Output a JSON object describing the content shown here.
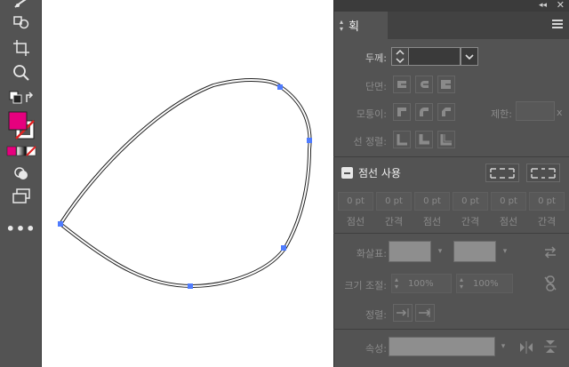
{
  "panel": {
    "tab_label": "획",
    "collapse_glyph": "◂◂",
    "close_glyph": "✕",
    "weight_label": "두께:",
    "weight_value": "",
    "cap_label": "단면:",
    "corner_label": "모퉁이:",
    "limit_label": "제한:",
    "limit_unit": "x",
    "align_label": "선 정렬:",
    "dashed_label": "점선 사용",
    "dash_fields": [
      {
        "value": "0 pt",
        "caption": "점선"
      },
      {
        "value": "0 pt",
        "caption": "간격"
      },
      {
        "value": "0 pt",
        "caption": "점선"
      },
      {
        "value": "0 pt",
        "caption": "간격"
      },
      {
        "value": "0 pt",
        "caption": "점선"
      },
      {
        "value": "0 pt",
        "caption": "간격"
      }
    ],
    "arrowheads_label": "화살표:",
    "scale_label": "크기 조절:",
    "scale_start": "100%",
    "scale_end": "100%",
    "align_arrow_label": "정렬:",
    "profile_label": "속성:"
  },
  "toolbar": {
    "more_label": "•••",
    "fill_color": "#e6007e",
    "stroke_color": "#ffffff"
  },
  "colors": {
    "anchor": "#4f7cff",
    "panel_bg": "#535353"
  }
}
